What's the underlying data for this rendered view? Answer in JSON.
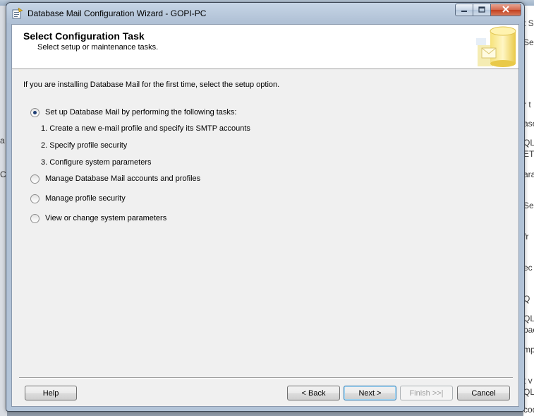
{
  "background": {
    "right_fragments": [
      "t S",
      "Se",
      "r t",
      "ase",
      "QL",
      "ETE",
      "ara",
      "Se",
      "fr",
      "ec",
      "Q",
      "QL",
      "pac",
      "mp",
      "t v",
      "QL",
      "code"
    ],
    "left_fragments": [
      "a",
      "C"
    ]
  },
  "window": {
    "title": "Database Mail Configuration Wizard - GOPI-PC",
    "icon": "wizard-app-icon",
    "minimize_icon": "minimize-icon",
    "maximize_icon": "maximize-icon",
    "close_icon": "close-icon"
  },
  "header": {
    "title": "Select Configuration Task",
    "subtitle": "Select setup or maintenance tasks.",
    "graphic": "database-graphic-icon"
  },
  "body": {
    "intro": "If you are installing Database Mail for the first time, select the setup option.",
    "options": [
      {
        "label": "Set up Database Mail by performing the following tasks:",
        "selected": true
      },
      {
        "label": "Manage Database Mail accounts and profiles",
        "selected": false
      },
      {
        "label": "Manage profile security",
        "selected": false
      },
      {
        "label": "View or change system parameters",
        "selected": false
      }
    ],
    "setup_steps": [
      "1. Create a new e-mail profile and specify its SMTP accounts",
      "2. Specify profile security",
      "3. Configure system parameters"
    ]
  },
  "buttons": {
    "help": "Help",
    "back": "< Back",
    "next": "Next >",
    "finish": "Finish >>|",
    "cancel": "Cancel"
  },
  "colors": {
    "accent_radio": "#1f3f74",
    "default_button_border": "#3c7fb1",
    "close_button": "#c2401f"
  }
}
